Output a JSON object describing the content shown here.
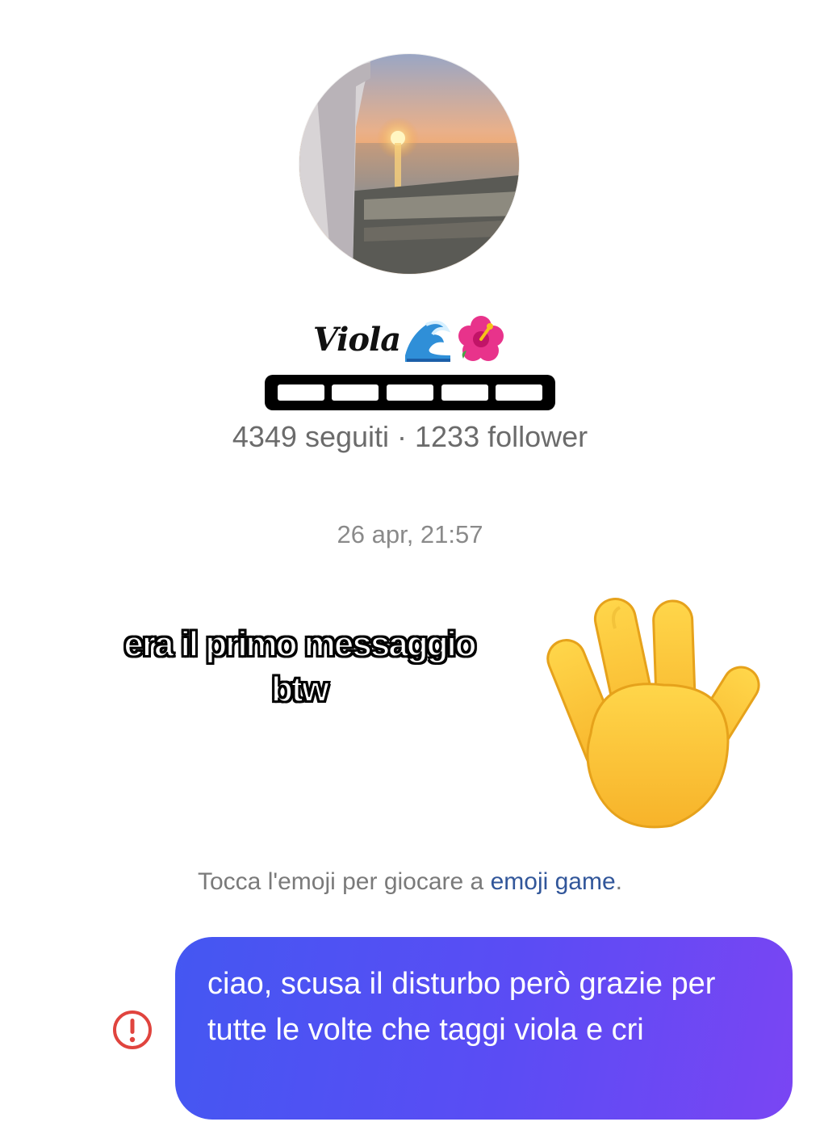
{
  "profile": {
    "avatar_icon": "sunset-sea-photo",
    "name": "Viola",
    "name_emojis": [
      "wave-emoji",
      "hibiscus-emoji"
    ],
    "stats": "4349 seguiti · 1233 follower"
  },
  "conversation": {
    "timestamp": "26 apr, 21:57",
    "overlay_caption_line1": "era il primo messaggio",
    "overlay_caption_line2": "btw",
    "received_emoji": "waving-hand-emoji",
    "emoji_hint_prefix": "Tocca l'emoji per giocare a ",
    "emoji_hint_link": "emoji game",
    "emoji_hint_suffix": ".",
    "sent_message": "ciao, scusa il disturbo però grazie per tutte le volte che taggi viola e cri",
    "sent_status_icon": "error-icon"
  },
  "colors": {
    "bubble_start": "#4457f2",
    "bubble_end": "#7a45f3",
    "link": "#31569a",
    "error": "#e0443e"
  }
}
